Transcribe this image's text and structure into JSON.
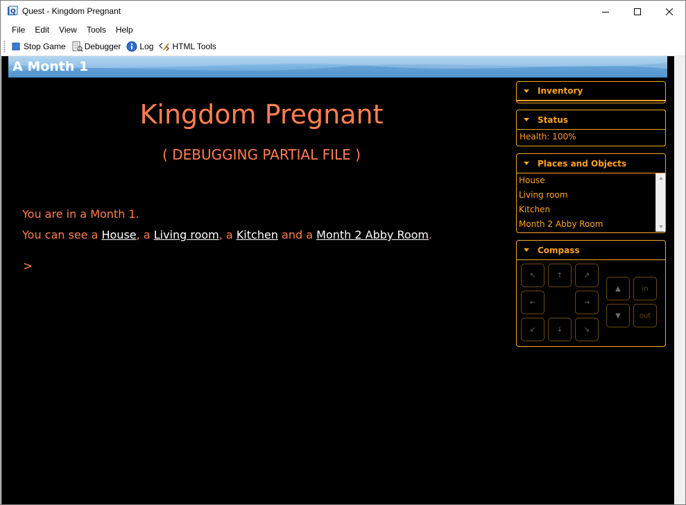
{
  "window": {
    "title": "Quest - Kingdom Pregnant"
  },
  "menu": [
    "File",
    "Edit",
    "View",
    "Tools",
    "Help"
  ],
  "toolbar": {
    "stop_game": "Stop Game",
    "debugger": "Debugger",
    "log": "Log",
    "html_tools": "HTML Tools"
  },
  "location": {
    "title": "A Month 1"
  },
  "game": {
    "title": "Kingdom Pregnant",
    "subtitle": "( DEBUGGING PARTIAL FILE )",
    "line1": "You are in a Month 1.",
    "line2_prefix": "You can see a ",
    "sep_a": ", a ",
    "sep_b": ", a ",
    "sep_and": " and a ",
    "line2_suffix": ".",
    "objects": [
      "House",
      "Living room",
      "Kitchen",
      "Month 2 Abby Room"
    ],
    "prompt": ">"
  },
  "panes": {
    "inventory": {
      "title": "Inventory"
    },
    "status": {
      "title": "Status",
      "health": "Health: 100%"
    },
    "places": {
      "title": "Places and Objects",
      "items": [
        "House",
        "Living room",
        "Kitchen",
        "Month 2 Abby Room"
      ]
    },
    "compass": {
      "title": "Compass",
      "in_label": "in",
      "out_label": "out"
    }
  },
  "colors": {
    "text": "#ff7f50",
    "accent": "#ffa420",
    "link": "#ffffff",
    "background": "#000000"
  }
}
